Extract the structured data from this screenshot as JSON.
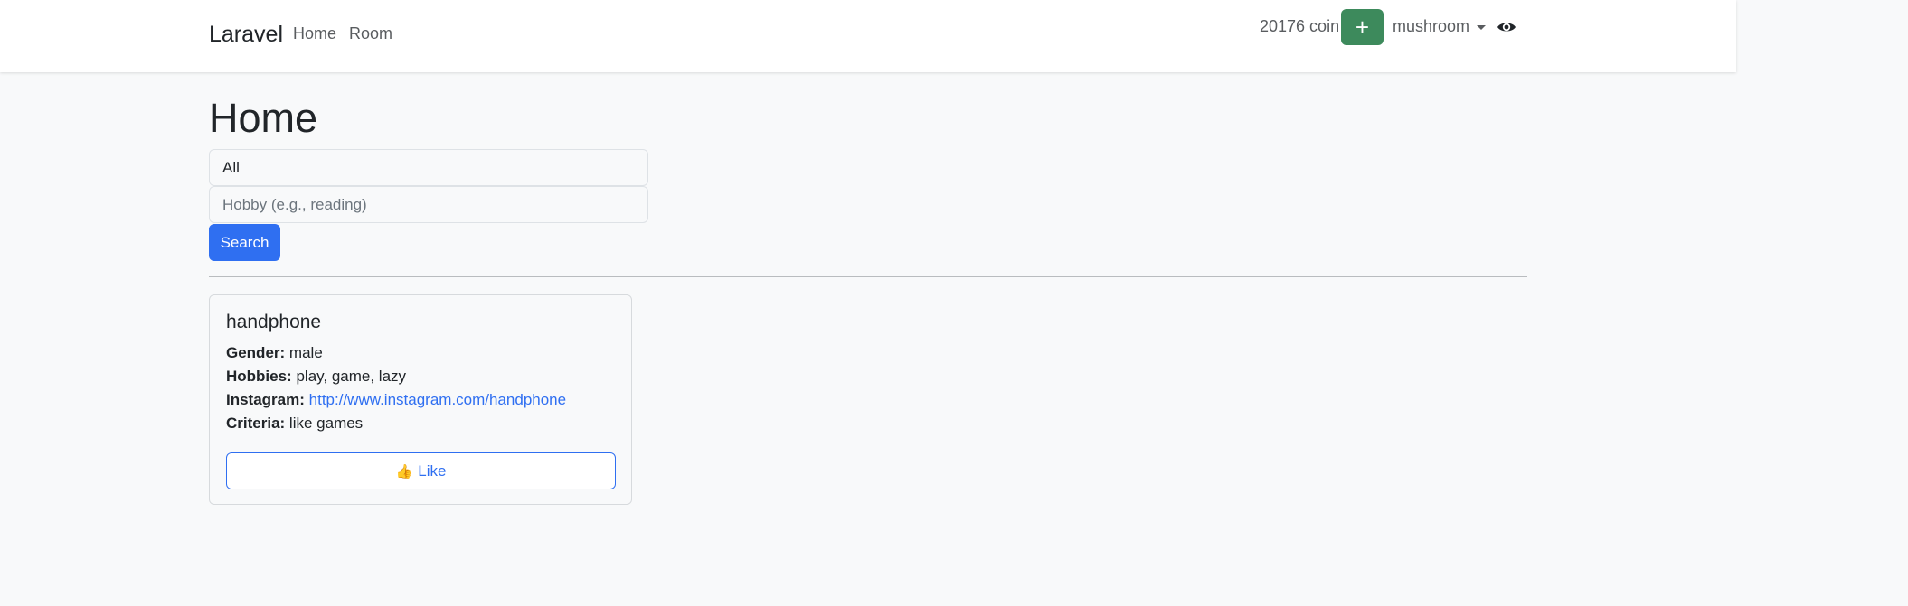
{
  "navbar": {
    "brand": "Laravel",
    "links": [
      "Home",
      "Room"
    ],
    "coins": "20176 coin",
    "add_button": "+",
    "username": "mushroom",
    "icons": [
      "plus-icon",
      "caret-down-icon",
      "eye-icon"
    ]
  },
  "page": {
    "title": "Home"
  },
  "search": {
    "gender_select": "All",
    "hobby_placeholder": "Hobby (e.g., reading)",
    "hobby_value": "",
    "button": "Search"
  },
  "profile": {
    "name": "handphone",
    "gender_label": "Gender:",
    "gender": "male",
    "hobbies_label": "Hobbies:",
    "hobbies": "play, game, lazy",
    "instagram_label": "Instagram:",
    "instagram": "http://www.instagram.com/handphone",
    "criteria_label": "Criteria:",
    "criteria": "like games",
    "like_button": "Like",
    "like_icon": "👍"
  },
  "colors": {
    "background": "#f8f9fa",
    "primary": "#2f6ff1",
    "success": "#3d8a5c"
  }
}
